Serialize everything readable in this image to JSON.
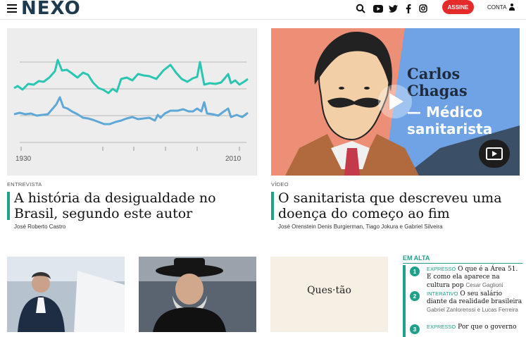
{
  "header": {
    "logo": "NEXO",
    "assine_label": "ASSINE",
    "conta_label": "CONTA",
    "icons": [
      "search-icon",
      "youtube-icon",
      "twitter-icon",
      "facebook-icon",
      "instagram-icon",
      "user-icon"
    ]
  },
  "featured": [
    {
      "kicker": "ENTREVISTA",
      "title": "A história da desigualdade no Brasil, segundo este autor",
      "byline": "José Roberto Castro",
      "chart": {
        "type": "line",
        "x_ticks": [
          "1930",
          "2010"
        ]
      }
    },
    {
      "kicker": "VÍDEO",
      "title": "O sanitarista que descreveu uma doença do começo ao fim",
      "byline": "José Orenstein Denis Burgierman, Tiago Jokura e Gabriel Silveira",
      "overlay": {
        "line1": "Carlos",
        "line2": "Chagas",
        "line3": "— Médico",
        "line4": "sanitarista"
      }
    }
  ],
  "second_row": {
    "question_title": "Ques·tão"
  },
  "em_alta": {
    "title": "EM ALTA",
    "items": [
      {
        "num": "1",
        "label": "EXPRESSO",
        "title": "O que é a Área 51. E como ela aparece na cultura pop",
        "byline": "Cesar Gaglioni"
      },
      {
        "num": "2",
        "label": "INTERATIVO",
        "title": "O seu salário diante da realidade brasileira",
        "byline": "Gabriel Zanlorenssi e Lucas Ferreira"
      },
      {
        "num": "3",
        "label": "EXPRESSO",
        "title": "Por que o governo",
        "byline": ""
      }
    ]
  },
  "colors": {
    "accent": "#1fa089",
    "brand_red": "#e52a2a"
  }
}
